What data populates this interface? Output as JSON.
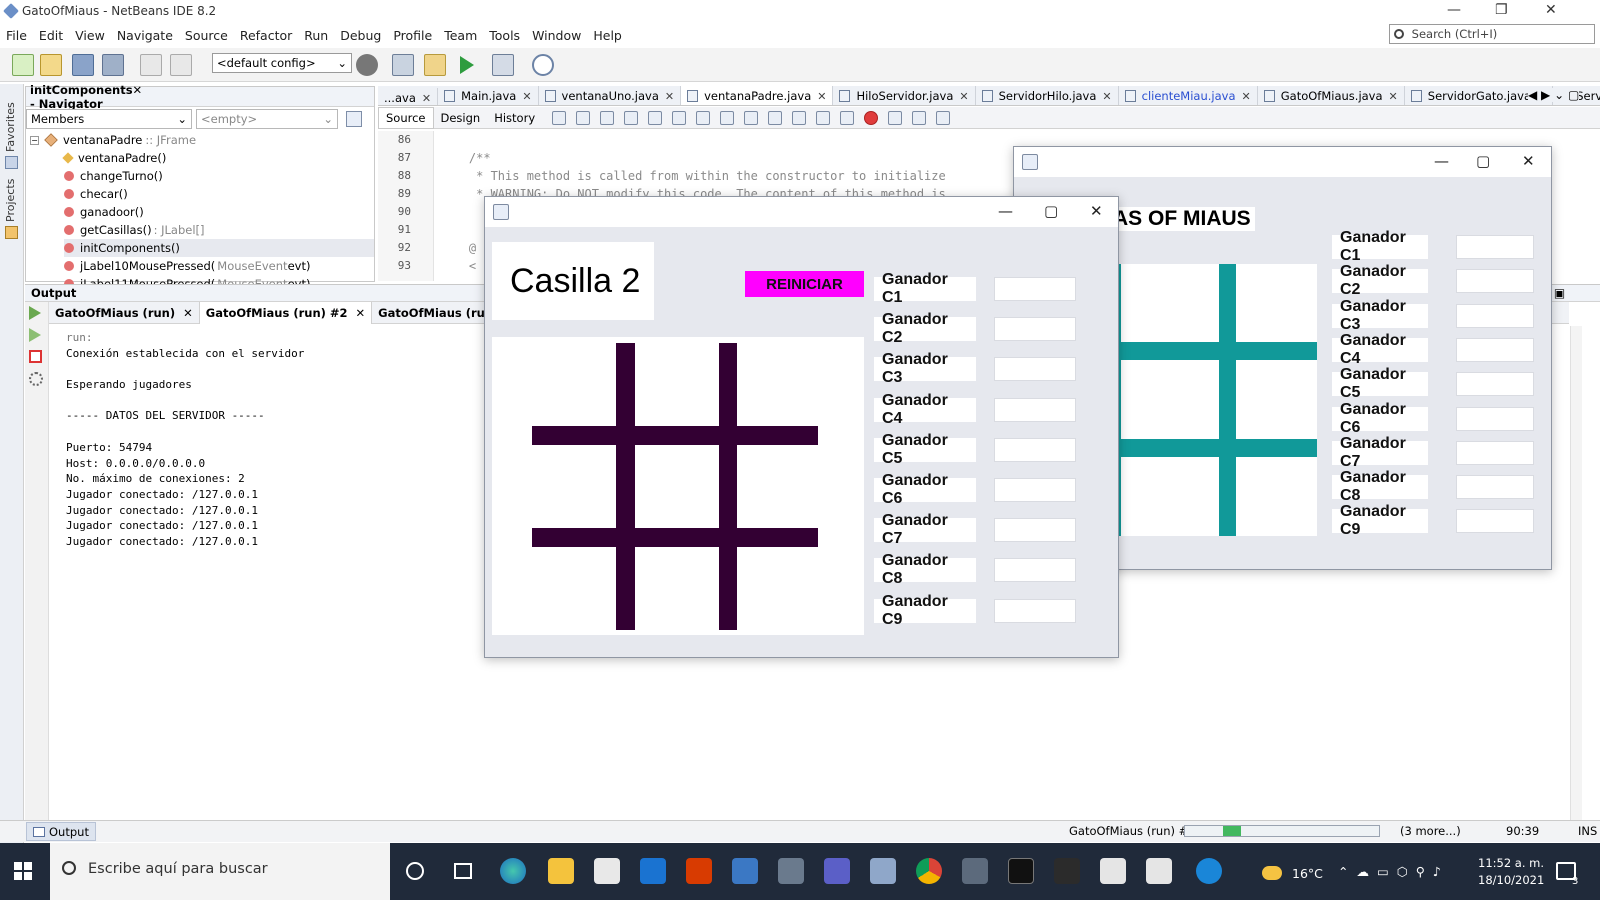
{
  "window": {
    "title": "GatoOfMiaus - NetBeans IDE 8.2"
  },
  "menu": [
    "File",
    "Edit",
    "View",
    "Navigate",
    "Source",
    "Refactor",
    "Run",
    "Debug",
    "Profile",
    "Team",
    "Tools",
    "Window",
    "Help"
  ],
  "search": {
    "placeholder": "Search (Ctrl+I)"
  },
  "toolbar": {
    "config": "<default config>"
  },
  "sidebar": {
    "favorites": "Favorites",
    "projects": "Projects"
  },
  "navigator": {
    "title": "initComponents - Navigator",
    "filter": "Members",
    "empty": "<empty>",
    "root": "ventanaPadre",
    "root_type": ":: JFrame",
    "items": [
      {
        "label": "ventanaPadre()",
        "kind": "constructor"
      },
      {
        "label": "changeTurno()",
        "kind": "method"
      },
      {
        "label": "checar()",
        "kind": "method"
      },
      {
        "label": "ganadoor()",
        "kind": "method"
      },
      {
        "label": "getCasillas()",
        "type": ": JLabel[]",
        "kind": "method"
      },
      {
        "label": "initComponents()",
        "kind": "method-selected"
      },
      {
        "label": "jLabel10MousePressed(",
        "type": "MouseEvent",
        "param": " evt)",
        "kind": "method"
      },
      {
        "label": "jLabel11MousePressed(",
        "type": "MouseEvent",
        "param": " evt)",
        "kind": "method"
      }
    ]
  },
  "editor": {
    "tabs": [
      "...ava",
      "Main.java",
      "ventanaUno.java",
      "ventanaPadre.java",
      "HiloServidor.java",
      "ServidorHilo.java",
      "clienteMiau.java",
      "GatoOfMiaus.java",
      "ServidorGato.java",
      "Servidor..."
    ],
    "subtabs": [
      "Source",
      "Design",
      "History"
    ],
    "lines": [
      {
        "n": "86",
        "text": ""
      },
      {
        "n": "87",
        "text": "    /**"
      },
      {
        "n": "88",
        "text": "     * This method is called from within the constructor to initialize"
      },
      {
        "n": "89",
        "text": "     * WARNING: Do NOT modify this code. The content of this method is"
      },
      {
        "n": "90",
        "text": ""
      },
      {
        "n": "91",
        "text": ""
      },
      {
        "n": "92",
        "text": "    @"
      },
      {
        "n": "93",
        "text": "    <"
      }
    ]
  },
  "output": {
    "title": "Output",
    "tabs": [
      "GatoOfMiaus (run)",
      "GatoOfMiaus (run) #2",
      "GatoOfMiaus (run) #3"
    ],
    "lines": [
      "run:",
      "Conexión establecida con el servidor",
      "",
      "Esperando jugadores",
      "",
      "----- DATOS DEL SERVIDOR -----",
      "",
      "Puerto: 54794",
      "Host: 0.0.0.0/0.0.0.0",
      "No. máximo de conexiones: 2",
      "Jugador conectado: /127.0.0.1",
      "Jugador conectado: /127.0.0.1",
      "Jugador conectado: /127.0.0.1",
      "Jugador conectado: /127.0.0.1"
    ]
  },
  "status": {
    "output_tab": "Output",
    "task": "GatoOfMiaus (run) #2",
    "more": "(3 more...)",
    "position": "90:39",
    "mode": "INS"
  },
  "taskbar": {
    "search": "Escribe aquí para buscar",
    "temp": "16°C",
    "time": "11:52 a. m.",
    "date": "18/10/2021",
    "notif": "3"
  },
  "game_front": {
    "casilla": "Casilla 2",
    "reiniciar": "REINICIAR",
    "ganadores": [
      "Ganador C1",
      "Ganador C2",
      "Ganador C3",
      "Ganador C4",
      "Ganador C5",
      "Ganador C6",
      "Ganador C7",
      "Ganador C8",
      "Ganador C9"
    ],
    "grid_color": "#330033",
    "button_color": "#ff00ff"
  },
  "game_back": {
    "title_fragment": "AS OF MIAUS",
    "ganadores": [
      "Ganador C1",
      "Ganador C2",
      "Ganador C3",
      "Ganador C4",
      "Ganador C5",
      "Ganador C6",
      "Ganador C7",
      "Ganador C8",
      "Ganador C9"
    ],
    "grid_color": "#119999"
  }
}
